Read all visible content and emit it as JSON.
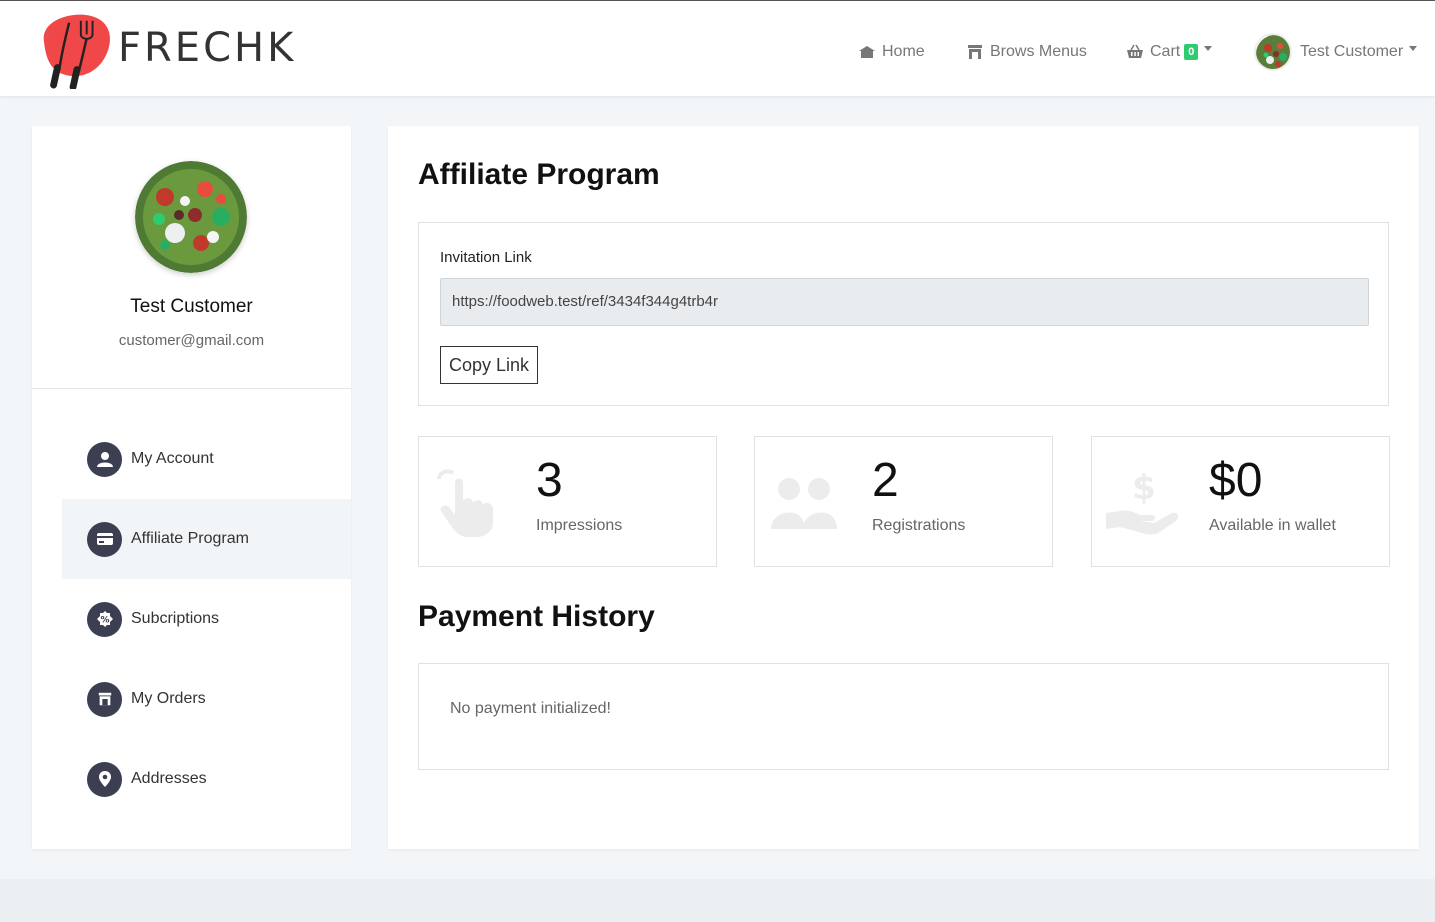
{
  "brand": {
    "name": "FRECHK",
    "accent": "#f04848"
  },
  "nav": {
    "home": "Home",
    "menus": "Brows Menus",
    "cart": "Cart",
    "cart_count": "0",
    "user": "Test Customer"
  },
  "profile": {
    "name": "Test Customer",
    "email": "customer@gmail.com"
  },
  "sidebar": {
    "items": [
      {
        "label": "My Account",
        "icon": "user-icon"
      },
      {
        "label": "Affiliate Program",
        "icon": "card-icon",
        "active": true
      },
      {
        "label": "Subcriptions",
        "icon": "badge-percent-icon"
      },
      {
        "label": "My Orders",
        "icon": "store-icon"
      },
      {
        "label": "Addresses",
        "icon": "map-pin-icon"
      }
    ]
  },
  "main": {
    "title": "Affiliate Program",
    "invitation": {
      "label": "Invitation Link",
      "url": "https://foodweb.test/ref/3434f344g4trb4r",
      "copy_label": "Copy Link"
    },
    "stats": [
      {
        "value": "3",
        "label": "Impressions",
        "icon": "pointer-hand-icon"
      },
      {
        "value": "2",
        "label": "Registrations",
        "icon": "users-icon"
      },
      {
        "value": "$0",
        "label": "Available in wallet",
        "icon": "hand-dollar-icon"
      }
    ],
    "payment_history": {
      "title": "Payment History",
      "empty": "No payment initialized!"
    }
  }
}
